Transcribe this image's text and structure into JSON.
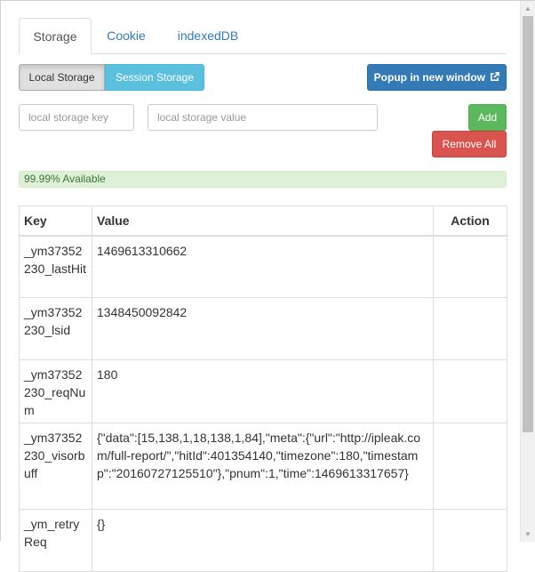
{
  "tabs": [
    {
      "label": "Storage",
      "active": true
    },
    {
      "label": "Cookie",
      "active": false
    },
    {
      "label": "indexedDB",
      "active": false
    }
  ],
  "storage_toggle": {
    "local_label": "Local Storage",
    "session_label": "Session Storage",
    "selected": "Local Storage"
  },
  "popup_button_label": "Popup in new window",
  "popup_icon": "external-link-icon",
  "key_field": {
    "placeholder": "local storage key",
    "value": ""
  },
  "value_field": {
    "placeholder": "local storage value",
    "value": ""
  },
  "add_button_label": "Add",
  "remove_all_button_label": "Remove All",
  "availability": {
    "label": "99.99% Available",
    "fraction": 0.9999
  },
  "table": {
    "headers": {
      "key": "Key",
      "value": "Value",
      "action": "Action"
    },
    "rows": [
      {
        "key": "_ym37352230_lastHit",
        "value": "1469613310662",
        "action": ""
      },
      {
        "key": "_ym37352230_lsid",
        "value": "1348450092842",
        "action": ""
      },
      {
        "key": "_ym37352230_reqNum",
        "value": "180",
        "action": ""
      },
      {
        "key": "_ym37352230_visorbuff",
        "value": "{\"data\":[15,138,1,18,138,1,84],\"meta\":{\"url\":\"http://ipleak.com/full-report/\",\"hitId\":401354140,\"timezone\":180,\"timestamp\":\"20160727125510\"},\"pnum\":1,\"time\":1469613317657}",
        "action": ""
      },
      {
        "key": "_ym_retryReq",
        "value": "{}",
        "action": ""
      }
    ]
  },
  "colors": {
    "primary": "#337ab7",
    "info": "#5bc0de",
    "success": "#5cb85c",
    "danger": "#d9534f",
    "progress_bg": "#dff0d8"
  }
}
